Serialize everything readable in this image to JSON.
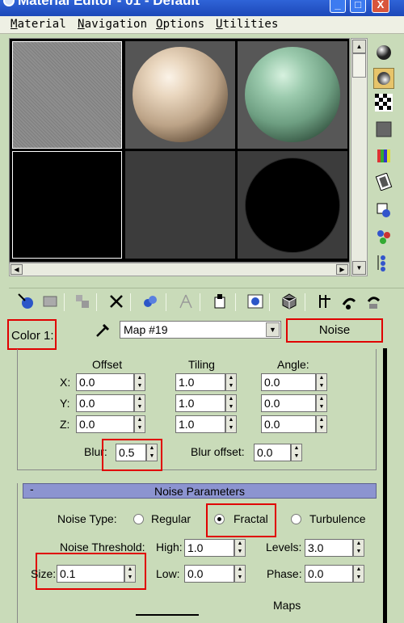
{
  "window": {
    "title": "Material Editor - 01 - Default",
    "min_label": "_",
    "max_label": "□",
    "close_label": "X"
  },
  "menu": [
    {
      "first": "M",
      "rest": "aterial"
    },
    {
      "first": "N",
      "rest": "avigation"
    },
    {
      "first": "O",
      "rest": "ptions"
    },
    {
      "first": "U",
      "rest": "tilities"
    }
  ],
  "slots": [
    "flat-gray-sample",
    "cream-sphere",
    "green-sphere",
    "black-sample",
    "empty-slot",
    "black-sphere"
  ],
  "map": {
    "color_label": "Color 1:",
    "map_name": "Map #19",
    "map_type": "Noise"
  },
  "coords": {
    "offset_header": "Offset",
    "tiling_header": "Tiling",
    "angle_header": "Angle:",
    "rows": [
      {
        "axis": "X:",
        "offset": "0.0",
        "tiling": "1.0",
        "angle": "0.0"
      },
      {
        "axis": "Y:",
        "offset": "0.0",
        "tiling": "1.0",
        "angle": "0.0"
      },
      {
        "axis": "Z:",
        "offset": "0.0",
        "tiling": "1.0",
        "angle": "0.0"
      }
    ],
    "blur_label": "Blur:",
    "blur_value": "0.5",
    "blur_offset_label": "Blur offset:",
    "blur_offset_value": "0.0"
  },
  "noise": {
    "rollout_toggle": "-",
    "rollout_title": "Noise Parameters",
    "type_label": "Noise Type:",
    "types": [
      "Regular",
      "Fractal",
      "Turbulence"
    ],
    "selected_type": "Fractal",
    "threshold_label": "Noise Threshold:",
    "high_label": "High:",
    "high_value": "1.0",
    "levels_label": "Levels:",
    "levels_value": "3.0",
    "size_label": "Size:",
    "size_value": "0.1",
    "low_label": "Low:",
    "low_value": "0.0",
    "phase_label": "Phase:",
    "phase_value": "0.0",
    "maps_label": "Maps"
  },
  "colors": {
    "panel_bg": "#c9dbb9",
    "highlight": "#e00000",
    "rollout_bar": "#8c94d0"
  }
}
